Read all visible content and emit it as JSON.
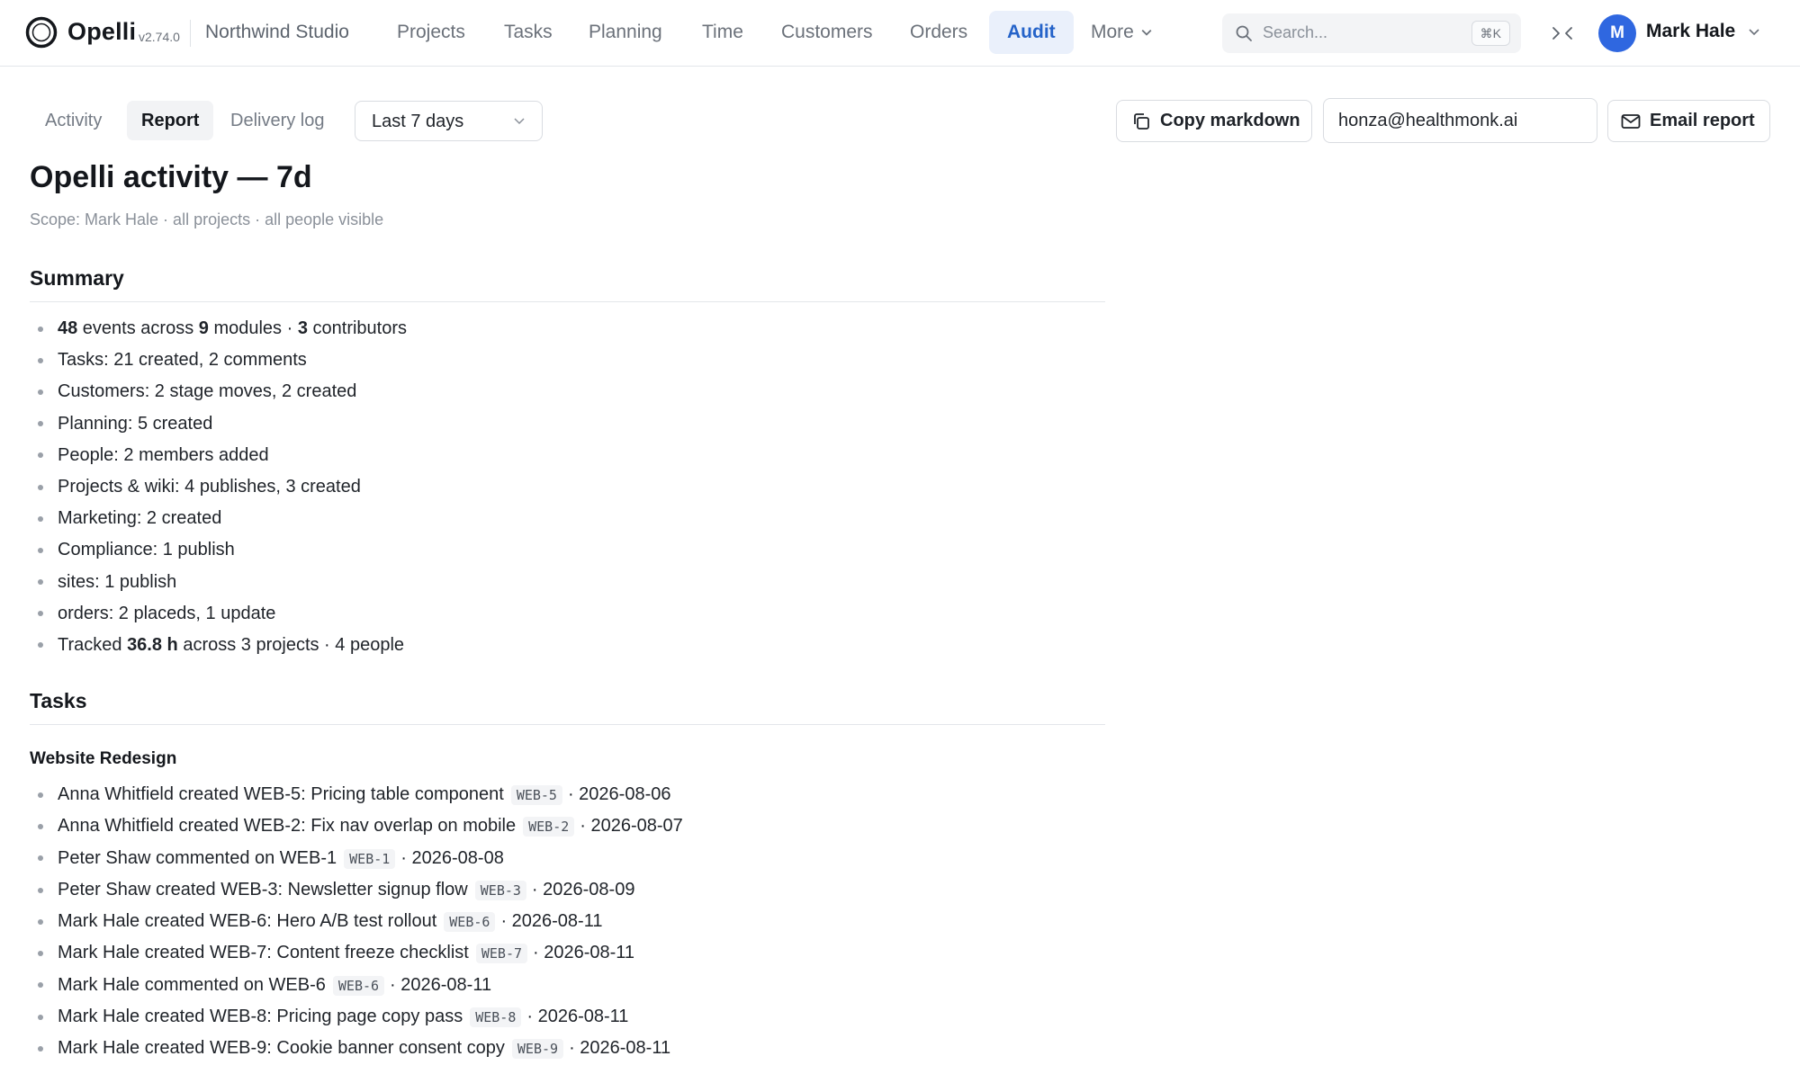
{
  "header": {
    "brand": "Opelli",
    "version": "v2.74.0",
    "workspace": "Northwind Studio",
    "nav": [
      {
        "label": "Projects",
        "active": false
      },
      {
        "label": "Tasks",
        "active": false
      },
      {
        "label": "Planning",
        "active": false
      },
      {
        "label": "Time",
        "active": false
      },
      {
        "label": "Customers",
        "active": false
      },
      {
        "label": "Orders",
        "active": false
      },
      {
        "label": "Audit",
        "active": true
      },
      {
        "label": "More",
        "active": false
      }
    ],
    "search": {
      "placeholder": "Search...",
      "shortcut": "⌘K"
    },
    "user": {
      "initial": "M",
      "name": "Mark Hale"
    }
  },
  "toolbar": {
    "tabs": [
      {
        "label": "Activity",
        "active": false
      },
      {
        "label": "Report",
        "active": true
      },
      {
        "label": "Delivery log",
        "active": false
      }
    ],
    "range": "Last 7 days",
    "copy_label": "Copy markdown",
    "email_value": "honza@healthmonk.ai",
    "email_label": "Email report"
  },
  "report": {
    "title": "Opelli activity — 7d",
    "scope": "Scope: Mark Hale · all projects · all people visible",
    "summary_heading": "Summary",
    "summary_first": {
      "events": "48",
      "t1": " events across ",
      "modules": "9",
      "t2": " modules · ",
      "contributors": "3",
      "t3": " contributors"
    },
    "summary_items": [
      "Tasks: 21 created, 2 comments",
      "Customers: 2 stage moves, 2 created",
      "Planning: 5 created",
      "People: 2 members added",
      "Projects & wiki: 4 publishes, 3 created",
      "Marketing: 2 created",
      "Compliance: 1 publish",
      "sites: 1 publish",
      "orders: 2 placeds, 1 update"
    ],
    "summary_last": {
      "t1": "Tracked ",
      "hours": "36.8 h",
      "t2": " across 3 projects · 4 people"
    },
    "tasks_heading": "Tasks",
    "project_heading": "Website Redesign",
    "tasks": [
      {
        "text": "Anna Whitfield created WEB-5: Pricing table component",
        "code": "WEB-5",
        "date": "· 2026-08-06"
      },
      {
        "text": "Anna Whitfield created WEB-2: Fix nav overlap on mobile",
        "code": "WEB-2",
        "date": "· 2026-08-07"
      },
      {
        "text": "Peter Shaw commented on WEB-1",
        "code": "WEB-1",
        "date": "· 2026-08-08"
      },
      {
        "text": "Peter Shaw created WEB-3: Newsletter signup flow",
        "code": "WEB-3",
        "date": "· 2026-08-09"
      },
      {
        "text": "Mark Hale created WEB-6: Hero A/B test rollout",
        "code": "WEB-6",
        "date": "· 2026-08-11"
      },
      {
        "text": "Mark Hale created WEB-7: Content freeze checklist",
        "code": "WEB-7",
        "date": "· 2026-08-11"
      },
      {
        "text": "Mark Hale commented on WEB-6",
        "code": "WEB-6",
        "date": "· 2026-08-11"
      },
      {
        "text": "Mark Hale created WEB-8: Pricing page copy pass",
        "code": "WEB-8",
        "date": "· 2026-08-11"
      },
      {
        "text": "Mark Hale created WEB-9: Cookie banner consent copy",
        "code": "WEB-9",
        "date": "· 2026-08-11"
      }
    ]
  },
  "colors": {
    "accent": "#2563c9",
    "accent_bg": "#eaf0fb",
    "avatar": "#2f67e0"
  },
  "icons": {
    "logo": "opelli-ring-logo",
    "search": "search-icon",
    "collapse": "collapse-icon",
    "copy": "copy-icon",
    "email": "mail-icon"
  }
}
